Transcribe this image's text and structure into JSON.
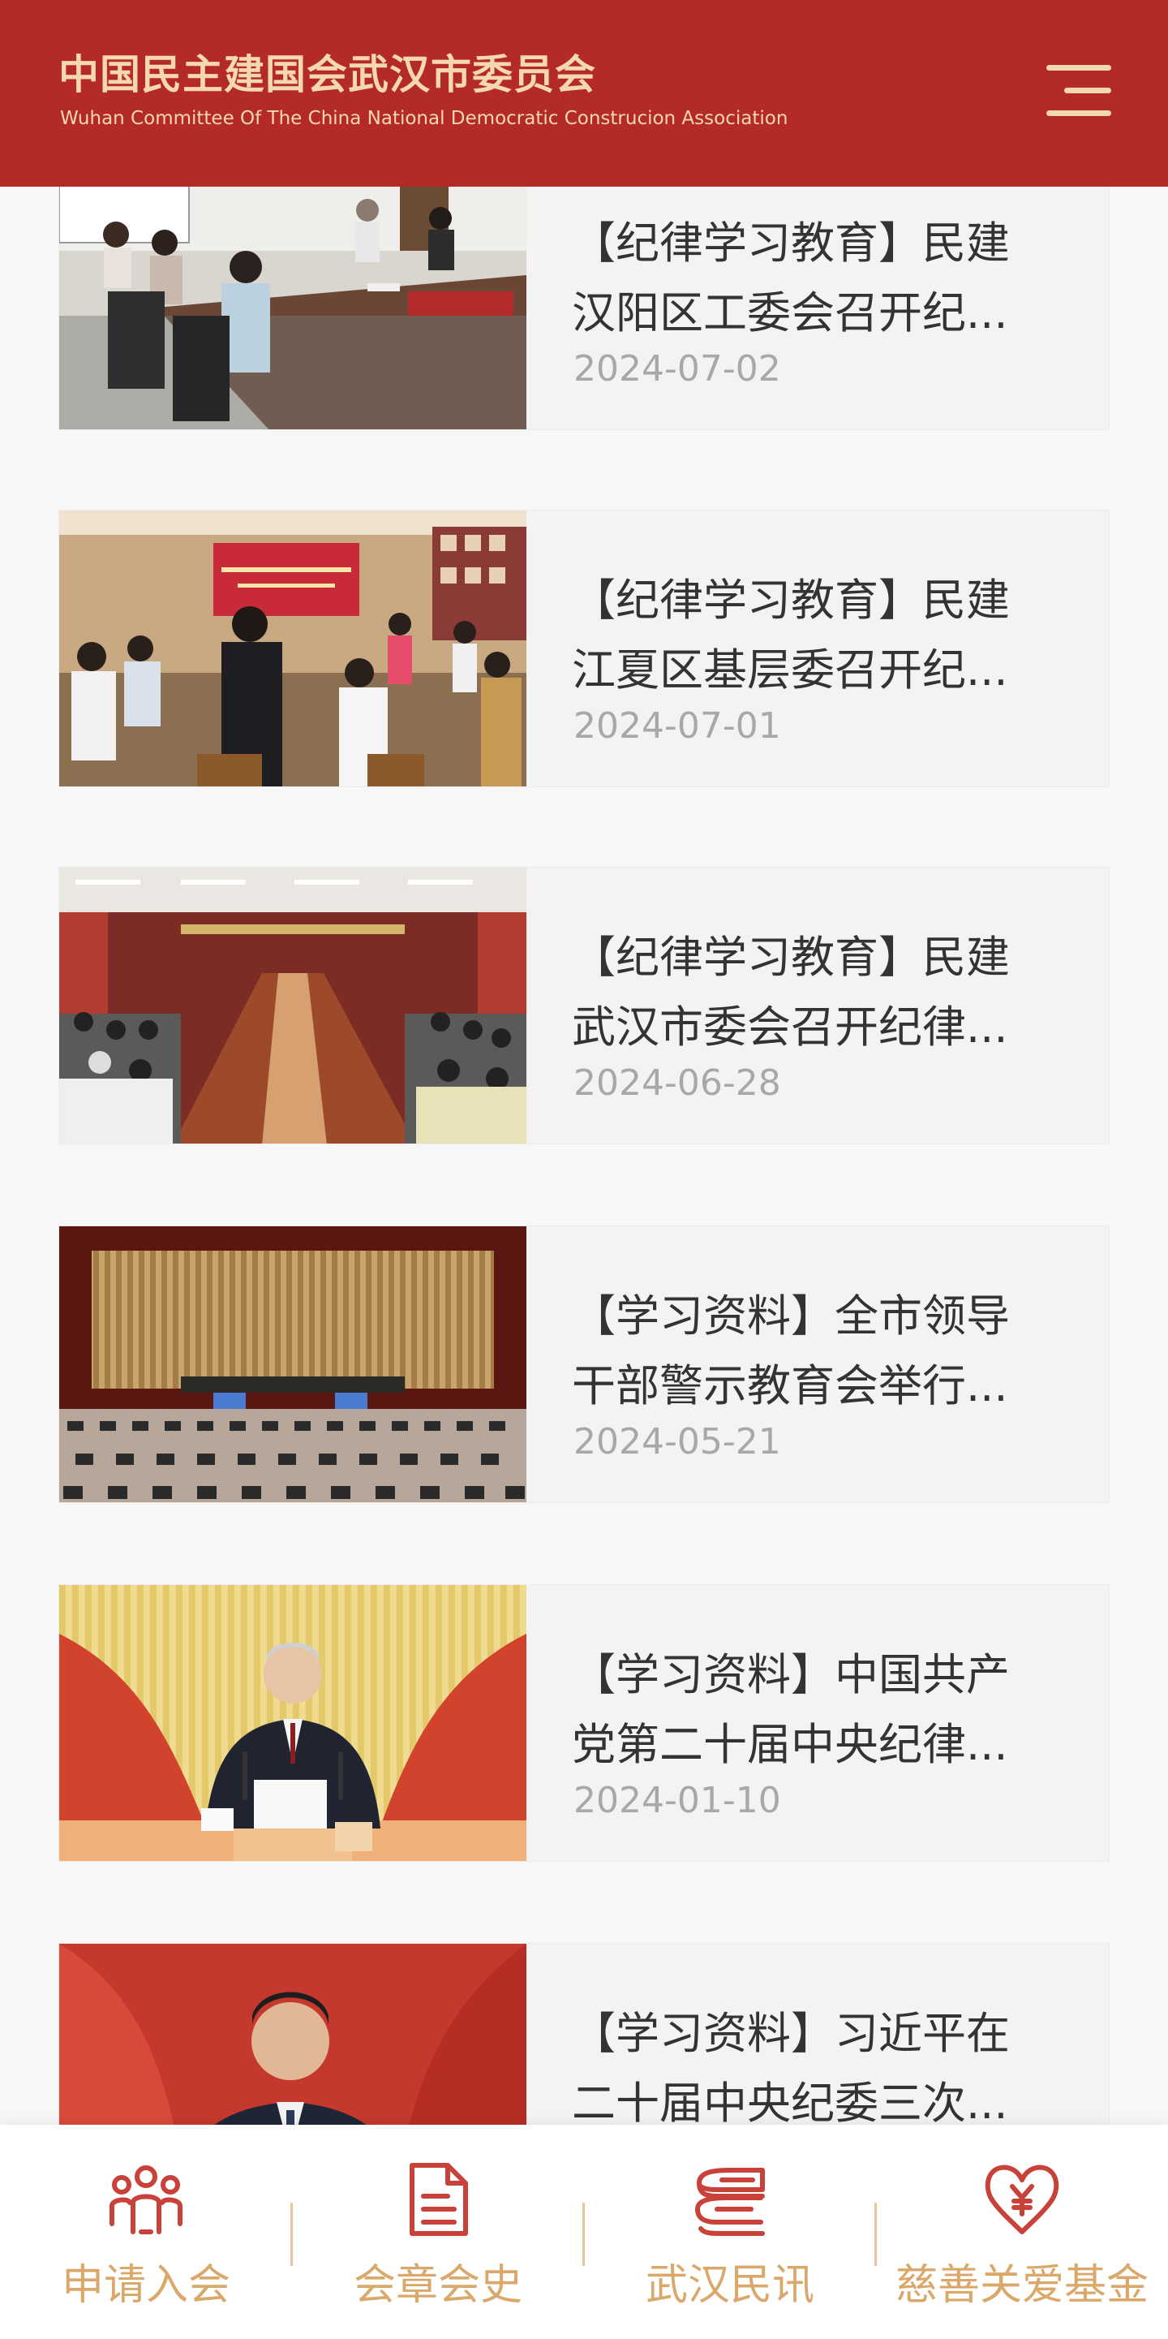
{
  "header": {
    "title_cn": "中国民主建国会武汉市委员会",
    "title_en": "Wuhan Committee Of The China National Democratic Construcion Association",
    "menu_icon": "menu-icon"
  },
  "colors": {
    "brand_red": "#b32b24",
    "gold": "#f5d8b0",
    "nav_gold": "#d9a86a",
    "icon_red": "#c9423a"
  },
  "news": [
    {
      "title_line1": "【纪律学习教育】民建",
      "title_line2": "汉阳区工委会召开纪...",
      "date": "2024-07-02"
    },
    {
      "title_line1": "【纪律学习教育】民建",
      "title_line2": "江夏区基层委召开纪...",
      "date": "2024-07-01"
    },
    {
      "title_line1": "【纪律学习教育】民建",
      "title_line2": "武汉市委会召开纪律...",
      "date": "2024-06-28"
    },
    {
      "title_line1": "【学习资料】全市领导",
      "title_line2": "干部警示教育会举行...",
      "date": "2024-05-21"
    },
    {
      "title_line1": "【学习资料】中国共产",
      "title_line2": "党第二十届中央纪律...",
      "date": "2024-01-10"
    },
    {
      "title_line1": "【学习资料】习近平在",
      "title_line2": "二十届中央纪委三次...",
      "date": ""
    }
  ],
  "bottom_nav": [
    {
      "label": "申请入会",
      "icon": "people-group-icon"
    },
    {
      "label": "会章会史",
      "icon": "document-icon"
    },
    {
      "label": "武汉民讯",
      "icon": "stacked-books-icon"
    },
    {
      "label": "慈善关爱基金",
      "icon": "heart-yuan-icon"
    }
  ]
}
